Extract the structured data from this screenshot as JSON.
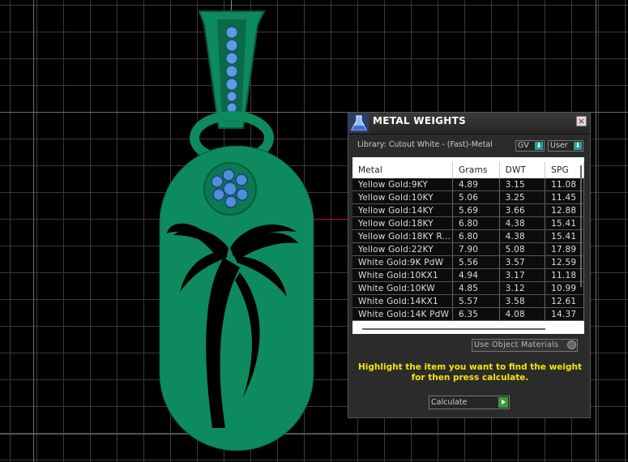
{
  "panel": {
    "title": "METAL WEIGHTS",
    "library_label": "Library: Cutout White - (Fast)-Metal",
    "gv_dropdown": "GV",
    "user_dropdown": "User",
    "close_glyph": "×",
    "columns": [
      "Metal",
      "Grams",
      "DWT",
      "SPG"
    ],
    "rows": [
      [
        "Yellow Gold:9KY",
        "4.89",
        "3.15",
        "11.08"
      ],
      [
        "Yellow Gold:10KY",
        "5.06",
        "3.25",
        "11.45"
      ],
      [
        "Yellow Gold:14KY",
        "5.69",
        "3.66",
        "12.88"
      ],
      [
        "Yellow Gold:18KY",
        "6.80",
        "4.38",
        "15.41"
      ],
      [
        "Yellow Gold:18KY R...",
        "6.80",
        "4.38",
        "15.41"
      ],
      [
        "Yellow Gold:22KY",
        "7.90",
        "5.08",
        "17.89"
      ],
      [
        "White Gold:9K PdW",
        "5.56",
        "3.57",
        "12.59"
      ],
      [
        "White Gold:10KX1",
        "4.94",
        "3.17",
        "11.18"
      ],
      [
        "White Gold:10KW",
        "4.85",
        "3.12",
        "10.99"
      ],
      [
        "White Gold:14KX1",
        "5.57",
        "3.58",
        "12.61"
      ],
      [
        "White Gold:14K PdW",
        "6.35",
        "4.08",
        "14.37"
      ]
    ],
    "use_object_materials": "Use Object Materials",
    "hint": "Highlight the item you want to find the weight for then press calculate.",
    "calculate_label": "Calculate"
  },
  "colors": {
    "pendant": "#0e8a5f",
    "pendant_dark": "#065c3c",
    "stone": "#4f8fd8",
    "hint": "#f2e50d"
  },
  "icons": [
    "app-flask-icon",
    "close-icon",
    "dropdown-arrow-icon",
    "play-icon"
  ]
}
